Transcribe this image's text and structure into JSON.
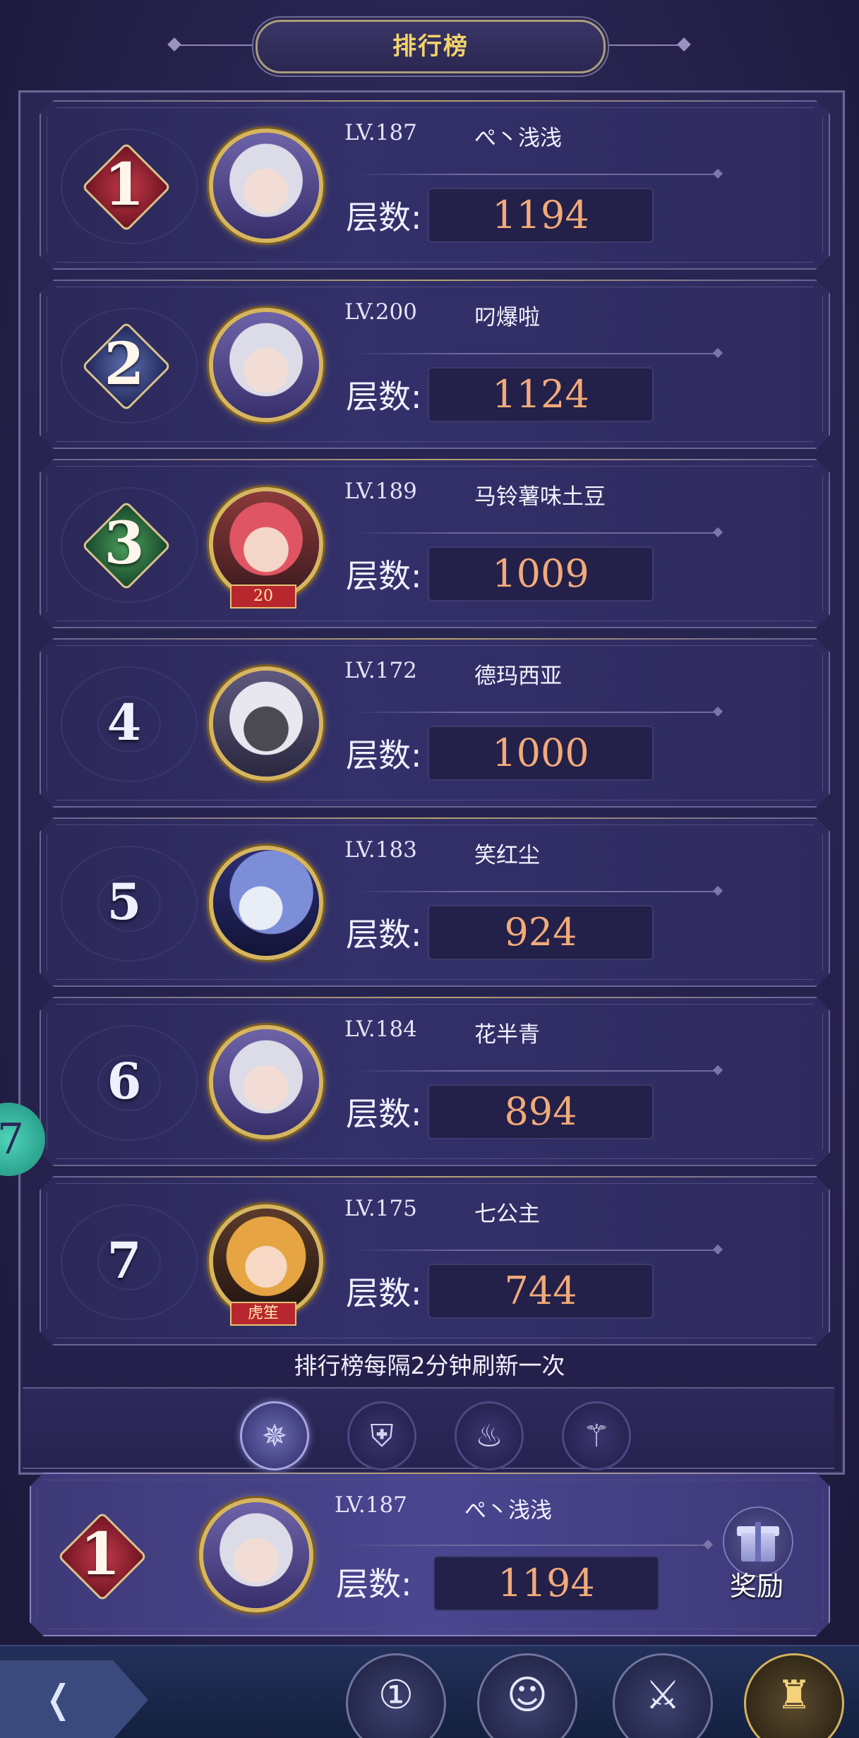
{
  "header": {
    "title": "排行榜"
  },
  "rows": [
    {
      "rank": "1",
      "level": "LV.187",
      "name": "ぺ丶浅浅",
      "floors_label": "层数:",
      "floors": "1194",
      "style": "r1",
      "face": ""
    },
    {
      "rank": "2",
      "level": "LV.200",
      "name": "叼爆啦",
      "floors_label": "层数:",
      "floors": "1124",
      "style": "r2",
      "face": ""
    },
    {
      "rank": "3",
      "level": "LV.189",
      "name": "马铃薯味土豆",
      "floors_label": "层数:",
      "floors": "1009",
      "style": "r3",
      "face": "pink",
      "avatar_tag": "20"
    },
    {
      "rank": "4",
      "level": "LV.172",
      "name": "德玛西亚",
      "floors_label": "层数:",
      "floors": "1000",
      "style": "plain",
      "face": "dark"
    },
    {
      "rank": "5",
      "level": "LV.183",
      "name": "笑红尘",
      "floors_label": "层数:",
      "floors": "924",
      "style": "plain",
      "face": "blue"
    },
    {
      "rank": "6",
      "level": "LV.184",
      "name": "花半青",
      "floors_label": "层数:",
      "floors": "894",
      "style": "plain",
      "face": ""
    },
    {
      "rank": "7",
      "level": "LV.175",
      "name": "七公主",
      "floors_label": "层数:",
      "floors": "744",
      "style": "plain",
      "face": "amber",
      "avatar_tag": "虎笙"
    }
  ],
  "refresh_note": "排行榜每隔2分钟刷新一次",
  "category_tabs": [
    {
      "icon": "compass-icon",
      "glyph": "✵",
      "active": true
    },
    {
      "icon": "helmet-icon",
      "glyph": "⛨",
      "active": false
    },
    {
      "icon": "flame-icon",
      "glyph": "♨",
      "active": false
    },
    {
      "icon": "trident-icon",
      "glyph": "⚚",
      "active": false
    }
  ],
  "my_rank": {
    "rank": "1",
    "level": "LV.187",
    "name": "ぺ丶浅浅",
    "floors_label": "层数:",
    "floors": "1194",
    "reward_label": "奖励"
  },
  "bottom_nav": {
    "back_icon": "back-arrow-icon",
    "buttons": [
      {
        "icon": "rank-shield-icon",
        "glyph": "①"
      },
      {
        "icon": "hero-portrait-icon",
        "glyph": "☺"
      },
      {
        "icon": "winged-sword-icon",
        "glyph": "⚔"
      },
      {
        "icon": "castle-tower-icon",
        "glyph": "♜",
        "gold": true
      }
    ]
  },
  "side_bubble": {
    "text": "7"
  },
  "colors": {
    "title": "#f3d36a",
    "floors_value": "#f1aa79",
    "background": "#26224d"
  }
}
